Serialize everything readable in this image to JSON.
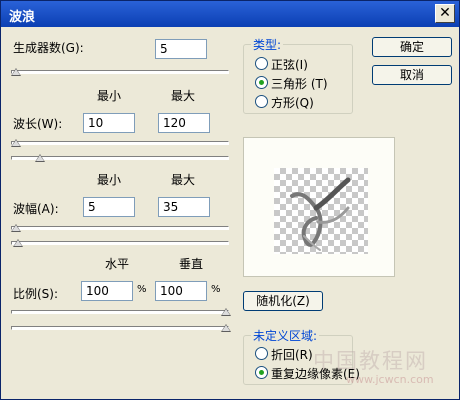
{
  "window": {
    "title": "波浪",
    "close_glyph": "✕"
  },
  "generators": {
    "label": "生成器数(G):",
    "value": "5",
    "slider_fraction": 0.0
  },
  "wavelength": {
    "min_header": "最小",
    "max_header": "最大",
    "label": "波长(W):",
    "min_value": "10",
    "max_value": "120",
    "min_slider_fraction": 0.0,
    "max_slider_fraction": 0.12
  },
  "amplitude": {
    "min_header": "最小",
    "max_header": "最大",
    "label": "波幅(A):",
    "min_value": "5",
    "max_value": "35",
    "min_slider_fraction": 0.0,
    "max_slider_fraction": 0.01
  },
  "scale": {
    "h_header": "水平",
    "v_header": "垂直",
    "label": "比例(S):",
    "h_value": "100",
    "v_value": "100",
    "unit": "%",
    "h_slider_fraction": 1.0,
    "v_slider_fraction": 1.0
  },
  "type_group": {
    "title": "类型:",
    "options": [
      {
        "label": "正弦(I)",
        "checked": false
      },
      {
        "label": "三角形 (T)",
        "checked": true
      },
      {
        "label": "方形(Q)",
        "checked": false
      }
    ]
  },
  "buttons": {
    "ok": "确定",
    "cancel": "取消",
    "randomize": "随机化(Z)"
  },
  "undefined_group": {
    "title": "未定义区域:",
    "options": [
      {
        "label": "折回(R)",
        "checked": false
      },
      {
        "label": "重复边缘像素(E)",
        "checked": true
      }
    ]
  },
  "watermark": {
    "line1": "中国教程网",
    "line2": "www.jcwcn.com"
  }
}
